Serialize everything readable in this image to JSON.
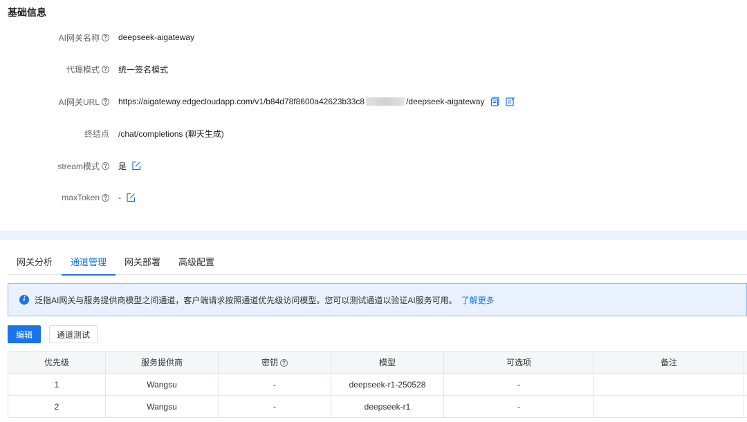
{
  "section": {
    "title": "基础信息"
  },
  "info": {
    "gateway_name": {
      "label": "AI网关名称",
      "value": "deepseek-aigateway"
    },
    "proxy_mode": {
      "label": "代理模式",
      "value": "统一签名模式"
    },
    "gateway_url": {
      "label": "AI网关URL",
      "value_prefix": "https://aigateway.edgecloudapp.com/v1/b84d78f8600a42623b33c8",
      "value_suffix": "/deepseek-aigateway"
    },
    "endpoint": {
      "label": "终结点",
      "value": "/chat/completions (聊天生成)"
    },
    "stream_mode": {
      "label": "stream模式",
      "value": "是"
    },
    "max_token": {
      "label": "maxToken",
      "value": "-"
    }
  },
  "tabs": [
    {
      "label": "网关分析",
      "active": false
    },
    {
      "label": "通道管理",
      "active": true
    },
    {
      "label": "网关部署",
      "active": false
    },
    {
      "label": "高级配置",
      "active": false
    }
  ],
  "alert": {
    "text": "泛指AI网关与服务提供商模型之间通道，客户端请求按照通道优先级访问模型。您可以测试通道以验证AI服务可用。",
    "link": "了解更多"
  },
  "buttons": {
    "edit": "编辑",
    "test": "通道测试"
  },
  "table": {
    "headers": [
      "优先级",
      "服务提供商",
      "密钥",
      "模型",
      "可选项",
      "备注"
    ],
    "rows": [
      [
        "1",
        "Wangsu",
        "-",
        "deepseek-r1-250528",
        "-",
        ""
      ],
      [
        "2",
        "Wangsu",
        "-",
        "deepseek-r1",
        "-",
        ""
      ]
    ]
  },
  "colors": {
    "accent": "#1a73e8",
    "alert_bg": "#e8f1fd",
    "alert_border": "#8fb8f2"
  },
  "icons": [
    "help-icon",
    "copy-icon",
    "edit-icon",
    "info-icon"
  ]
}
